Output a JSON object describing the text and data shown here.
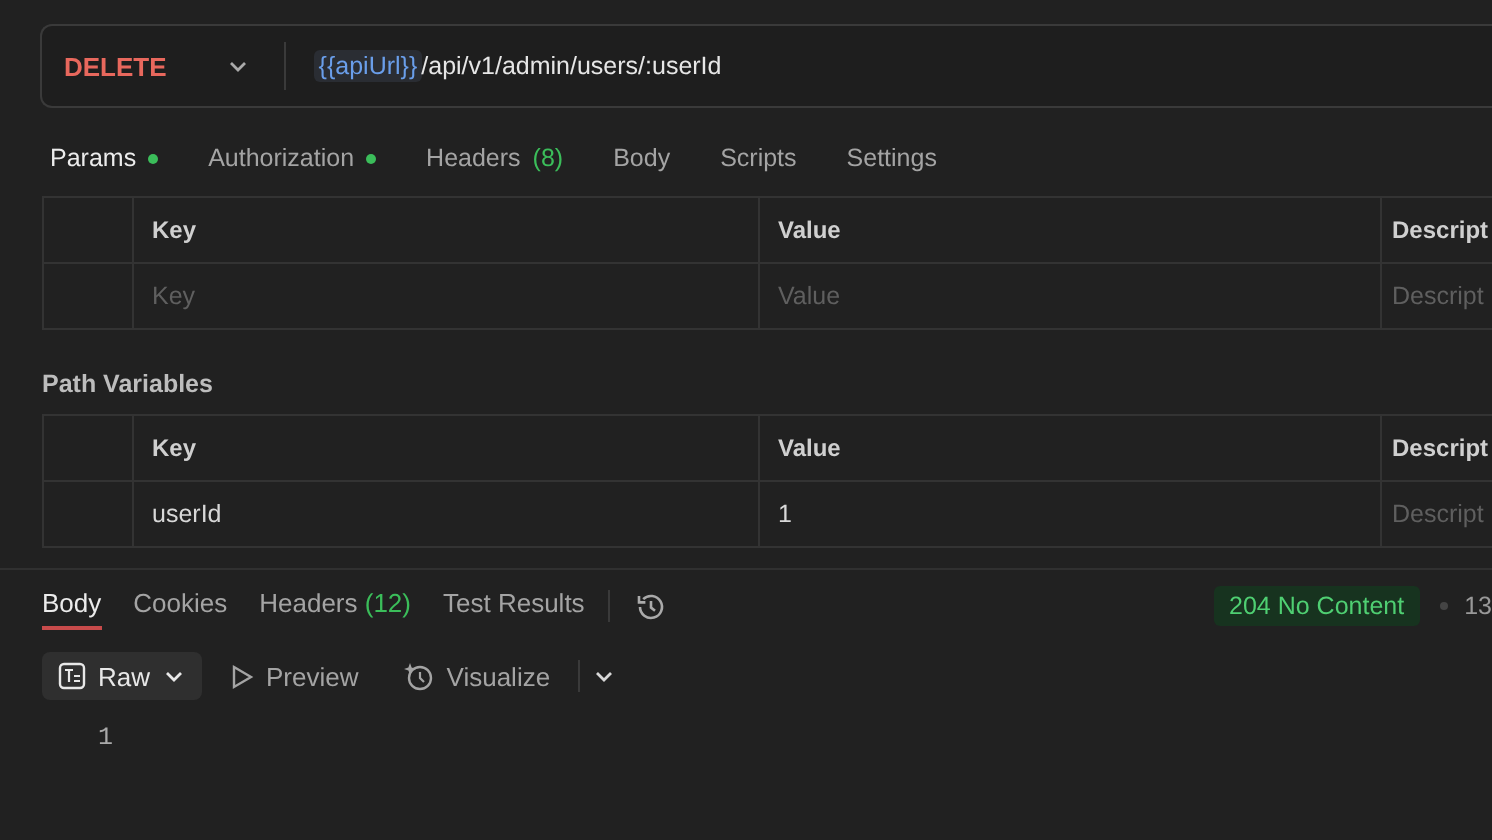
{
  "request": {
    "method": "DELETE",
    "url_variable": "{{apiUrl}}",
    "url_path": " /api/v1/admin/users/:userId"
  },
  "tabs": [
    {
      "label": "Params",
      "dot": true,
      "selected": true
    },
    {
      "label": "Authorization",
      "dot": true,
      "selected": false
    },
    {
      "label": "Headers",
      "count": "(8)",
      "selected": false
    },
    {
      "label": "Body",
      "selected": false
    },
    {
      "label": "Scripts",
      "selected": false
    },
    {
      "label": "Settings",
      "selected": false
    }
  ],
  "query_params": {
    "columns": [
      "Key",
      "Value",
      "Descript"
    ],
    "rows": [
      {
        "key": {
          "placeholder": "Key"
        },
        "value": {
          "placeholder": "Value"
        },
        "description": {
          "placeholder": "Descript"
        }
      }
    ]
  },
  "path_variables": {
    "title": "Path Variables",
    "columns": [
      "Key",
      "Value",
      "Descript"
    ],
    "rows": [
      {
        "key": {
          "value": "userId"
        },
        "value": {
          "value": "1"
        },
        "description": {
          "placeholder": "Descript"
        }
      }
    ]
  },
  "response": {
    "tabs": [
      {
        "label": "Body",
        "selected": true
      },
      {
        "label": "Cookies",
        "selected": false
      },
      {
        "label": "Headers",
        "count": "(12)",
        "selected": false
      },
      {
        "label": "Test Results",
        "selected": false
      }
    ],
    "status": "204 No Content",
    "time": "13",
    "view_modes": [
      {
        "label": "Raw",
        "kind": "dropdown",
        "selected": true
      },
      {
        "label": "Preview",
        "kind": "play",
        "selected": false
      },
      {
        "label": "Visualize",
        "kind": "visualize",
        "selected": false
      }
    ],
    "lines": [
      "1"
    ]
  }
}
